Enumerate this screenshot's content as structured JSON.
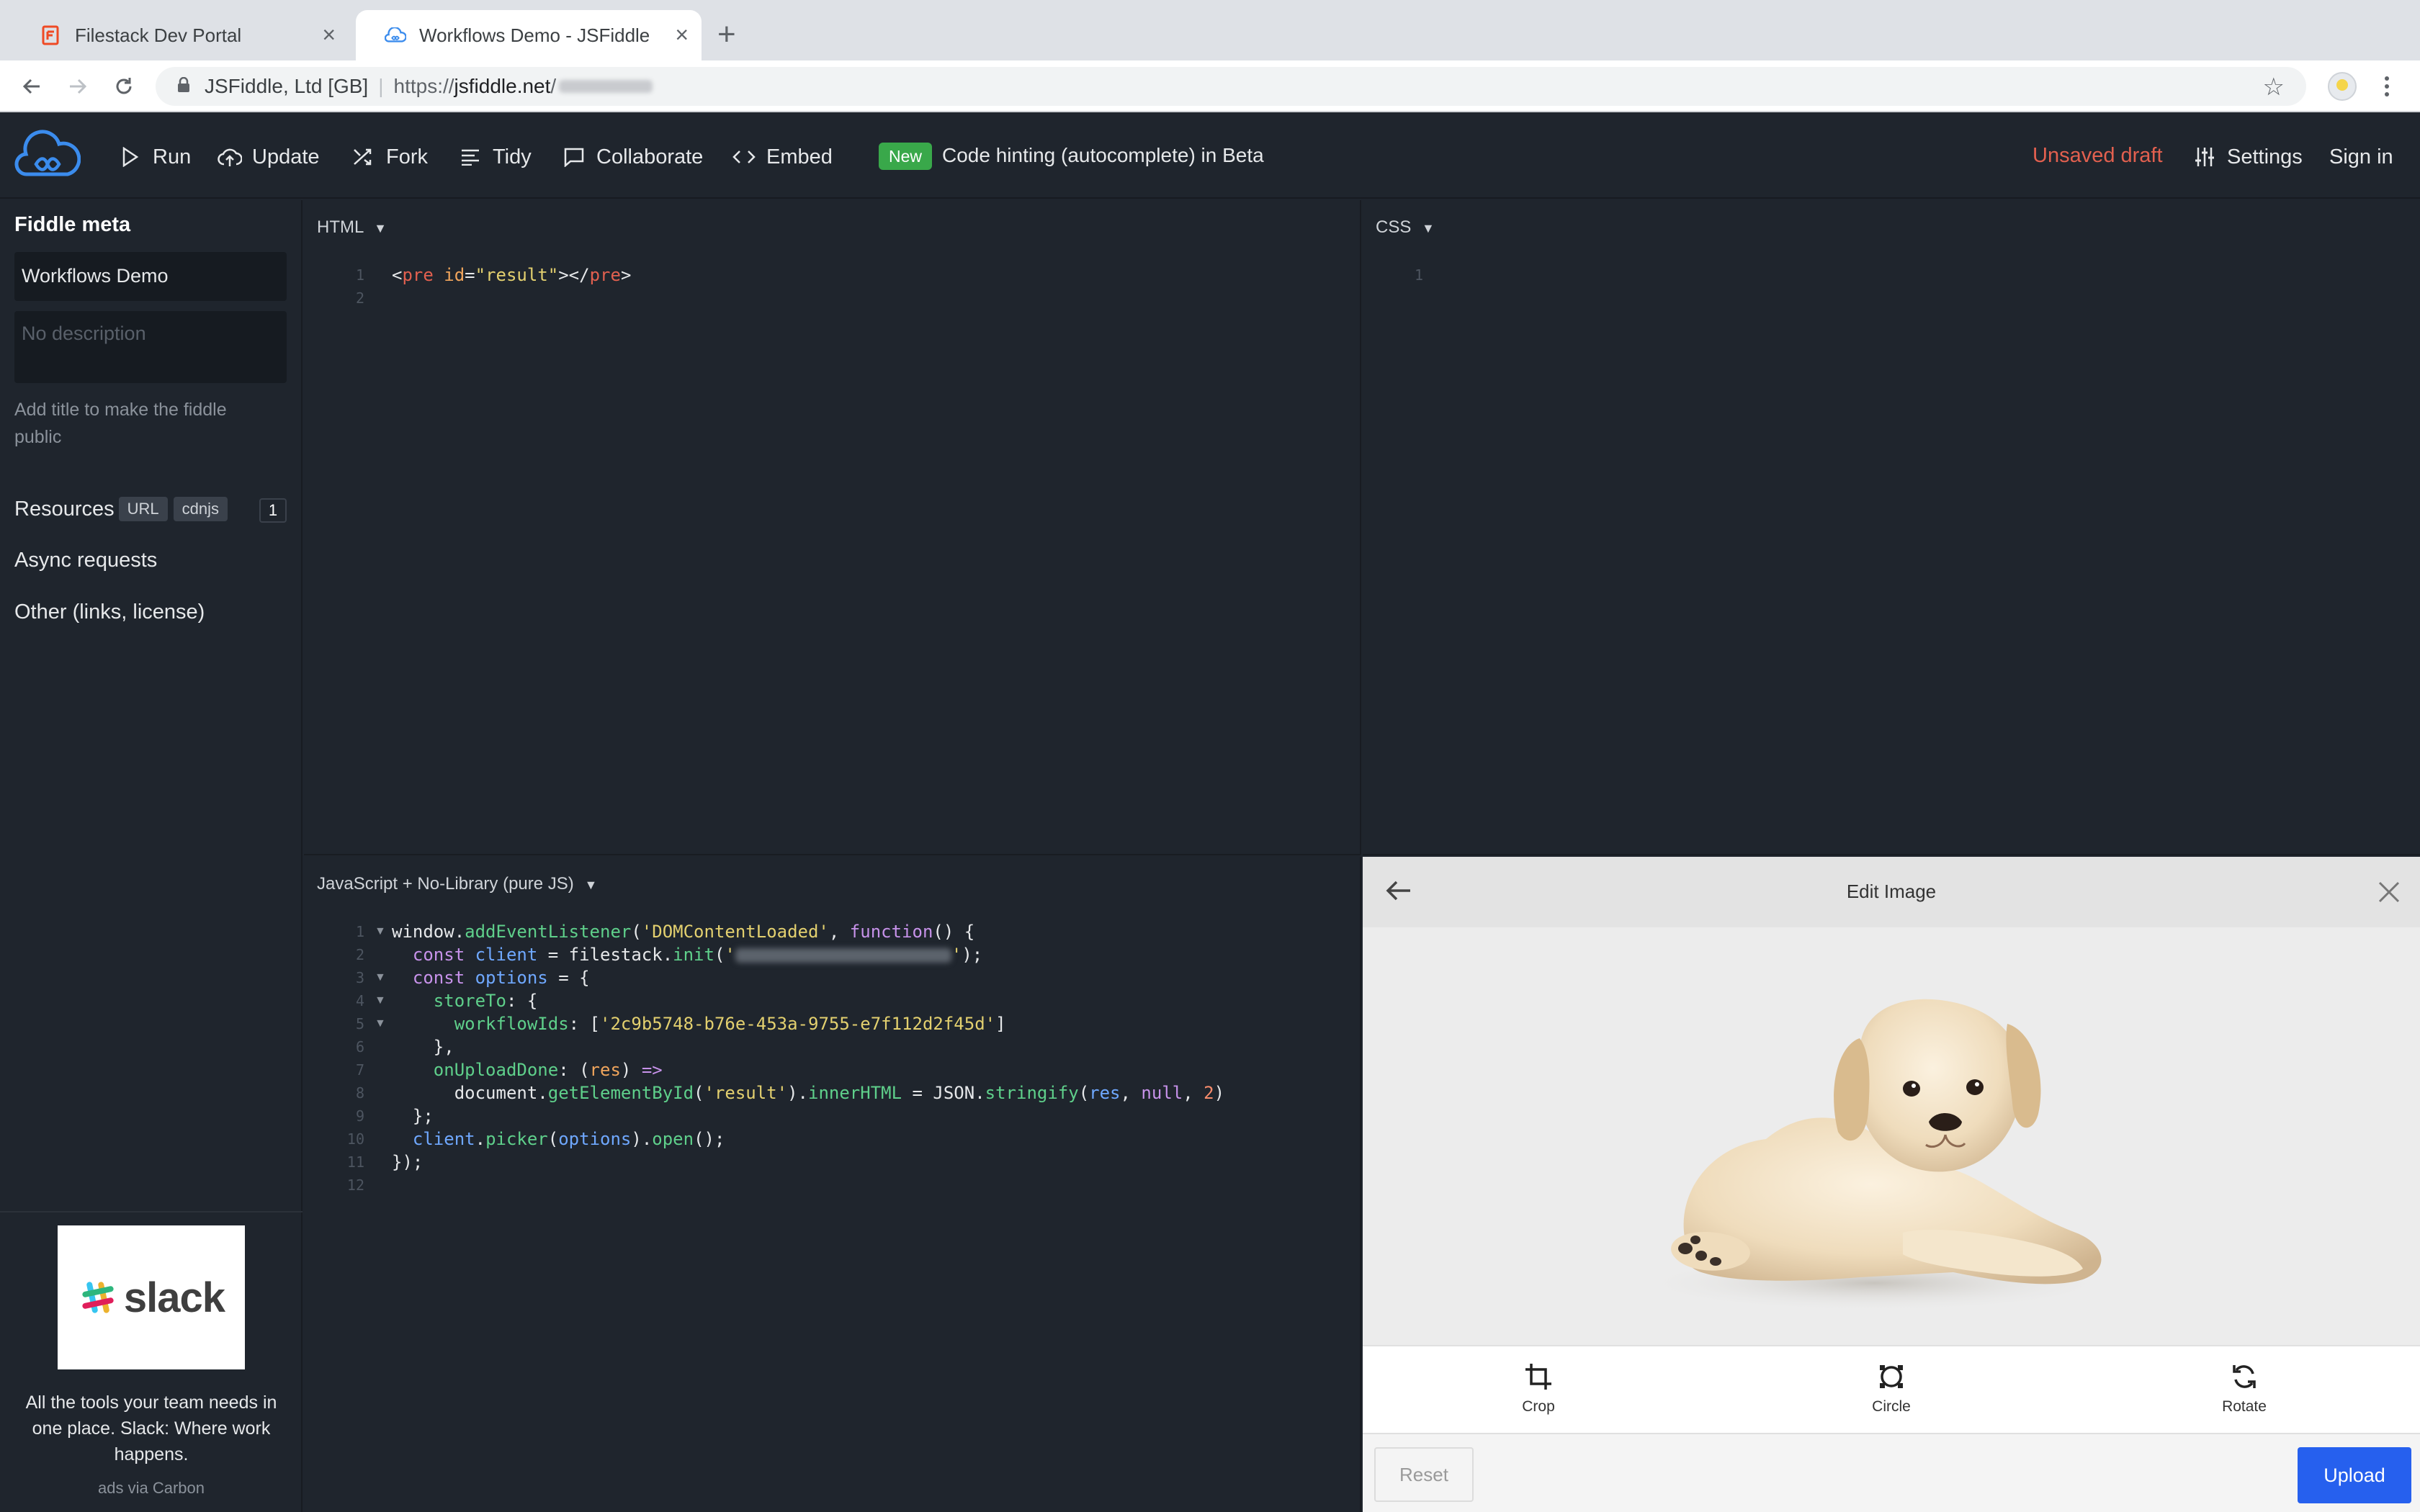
{
  "browser": {
    "tabs": [
      {
        "label": "Filestack Dev Portal",
        "icon": "filestack-favicon"
      },
      {
        "label": "Workflows Demo - JSFiddle",
        "icon": "jsfiddle-favicon"
      }
    ],
    "new_tab": "+",
    "tab_close": "×",
    "address": {
      "org": "JSFiddle, Ltd [GB]",
      "url_prefix": "https://",
      "url_host": "jsfiddle.net",
      "url_path": "/"
    }
  },
  "header": {
    "run": "Run",
    "update": "Update",
    "fork": "Fork",
    "tidy": "Tidy",
    "collaborate": "Collaborate",
    "embed": "Embed",
    "new_badge": "New",
    "beta_text": "Code hinting (autocomplete) in Beta",
    "unsaved": "Unsaved draft",
    "settings": "Settings",
    "sign_in": "Sign in"
  },
  "sidebar": {
    "meta_title": "Fiddle meta",
    "title_value": "Workflows Demo",
    "desc_placeholder": "No description",
    "hint": "Add title to make the fiddle public",
    "resources": "Resources",
    "chip_url": "URL",
    "chip_cdnjs": "cdnjs",
    "resources_count": "1",
    "async": "Async requests",
    "other": "Other (links, license)",
    "ad_logo": "slack",
    "ad_text": "All the tools your team needs in one place. Slack: Where work happens.",
    "ad_via": "ads via Carbon"
  },
  "panes": {
    "html_label": "HTML",
    "css_label": "CSS",
    "js_label": "JavaScript + No-Library (pure JS)",
    "dropdown": "▼"
  },
  "editor_image": {
    "title": "Edit Image",
    "tools": [
      "Crop",
      "Circle",
      "Rotate"
    ],
    "reset": "Reset",
    "upload": "Upload"
  },
  "colors": {
    "accent_blue": "#2660ee",
    "unsaved_red": "#e2604f",
    "badge_green": "#39a84a",
    "editor_bg": "#1f252d"
  }
}
